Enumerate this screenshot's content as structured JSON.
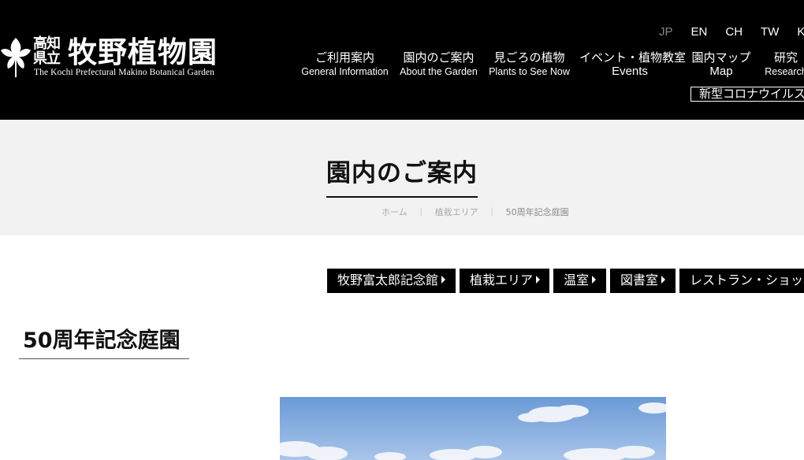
{
  "header": {
    "logo": {
      "small_text": "高知\n県立",
      "main_text": "牧野植物園",
      "english_text": "The Kochi Prefectural Makino Botanical Garden"
    },
    "languages": [
      {
        "label": "JP",
        "active": true
      },
      {
        "label": "EN",
        "active": false
      },
      {
        "label": "CH",
        "active": false
      },
      {
        "label": "TW",
        "active": false
      },
      {
        "label": "KR",
        "active": false
      }
    ],
    "nav": [
      {
        "ja": "ご利用案内",
        "en": "General Information"
      },
      {
        "ja": "園内のご案内",
        "en": "About the Garden"
      },
      {
        "ja": "見ごろの植物",
        "en": "Plants to See Now"
      },
      {
        "ja": "イベント・植物教室",
        "en": "Events"
      },
      {
        "ja": "園内マップ",
        "en": "Map"
      },
      {
        "ja": "研究",
        "en": "Research"
      }
    ],
    "notice": "新型コロナウイルス"
  },
  "title_band": {
    "title": "園内のご案内",
    "breadcrumb": [
      "ホーム",
      "植栽エリア",
      "50周年記念庭園"
    ],
    "separator": "｜"
  },
  "sub_nav": [
    {
      "label": "牧野富太郎記念館"
    },
    {
      "label": "植栽エリア"
    },
    {
      "label": "温室"
    },
    {
      "label": "図書室"
    },
    {
      "label": "レストラン・ショップ"
    }
  ],
  "section": {
    "heading": "50周年記念庭園"
  },
  "colors": {
    "header_bg": "#000000",
    "band_bg": "#f2f2f2",
    "button_bg": "#000000",
    "active_lang": "#888888"
  }
}
